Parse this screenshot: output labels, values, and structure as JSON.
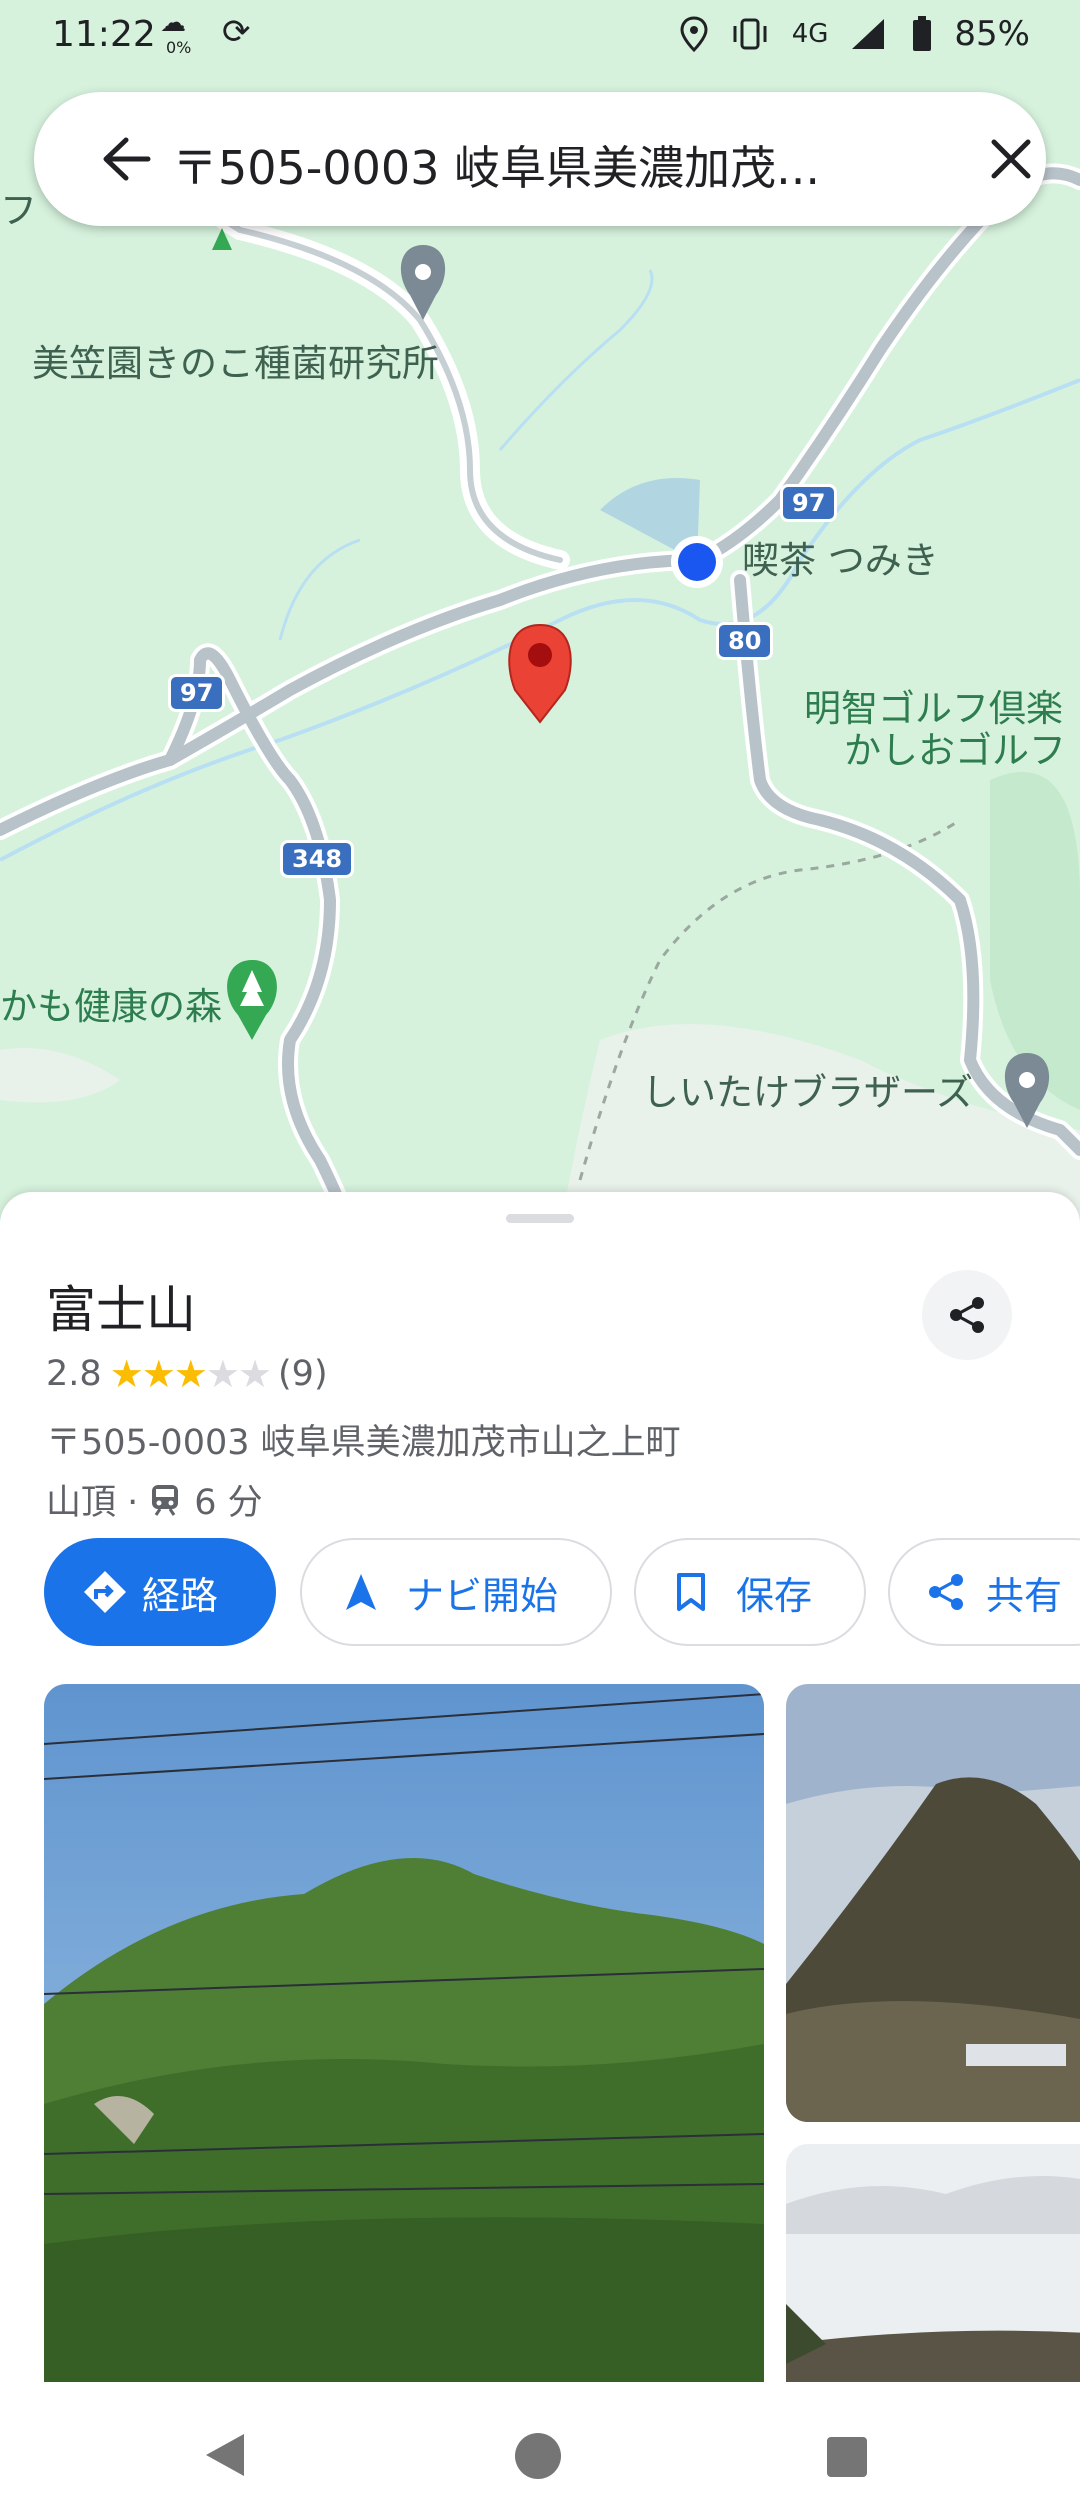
{
  "status_bar": {
    "time": "11:22",
    "weather_percent": "0%",
    "network": "4G",
    "battery": "85%"
  },
  "search": {
    "query": "〒505-0003 岐阜県美濃加茂..."
  },
  "map": {
    "labels": {
      "mushroom_lab": "美笠園きのこ種菌研究所",
      "cafe": "喫茶 つみき",
      "golf1": "明智ゴルフ倶楽",
      "golf2": "かしおゴルフ",
      "forest": "かも健康の森",
      "shiitake": "しいたけブラザーズ",
      "partial_top": "フ"
    },
    "routes": {
      "r97a": "97",
      "r97b": "97",
      "r80": "80",
      "r348": "348"
    }
  },
  "place": {
    "name": "富士山",
    "rating": "2.8",
    "rating_value": 2.8,
    "stars_filled": "★★★",
    "stars_empty": "★★",
    "review_count": "(9)",
    "address": "〒505-0003 岐阜県美濃加茂市山之上町",
    "category": "山頂 ·",
    "transit_time": "6 分"
  },
  "actions": {
    "directions": "経路",
    "navigate": "ナビ開始",
    "save": "保存",
    "share": "共有"
  },
  "colors": {
    "accent": "#1a73e8",
    "map_bg": "#d6f2dd",
    "pin": "#ea4335",
    "star": "#fbbc04"
  }
}
